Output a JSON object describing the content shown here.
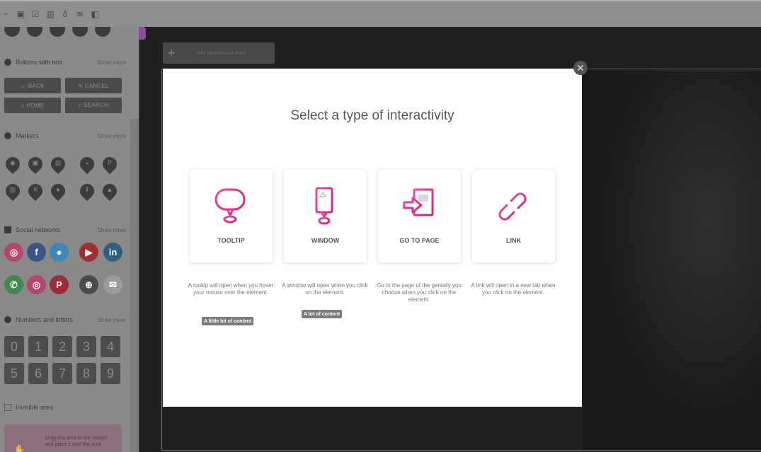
{
  "toolbar": {
    "icons": [
      "tilde-icon",
      "copy-icon",
      "checklist-icon",
      "trash-icon",
      "lock-icon",
      "layers-icon",
      "panel-icon"
    ]
  },
  "sidebar": {
    "buttons_section": {
      "title": "Buttons with text",
      "show_more": "Show more"
    },
    "text_buttons": [
      "← BACK",
      "✕ CANCEL",
      "⌂ HOME",
      "⌕ SEARCH"
    ],
    "markers_section": {
      "title": "Markers",
      "show_more": "Show more"
    },
    "social_section": {
      "title": "Social networks",
      "show_more": "Show more"
    },
    "social_icons": [
      {
        "name": "instagram-icon",
        "glyph": "◎",
        "color": "#b5456f"
      },
      {
        "name": "facebook-icon",
        "glyph": "f",
        "color": "#3a548a"
      },
      {
        "name": "twitter-icon",
        "glyph": "●",
        "color": "#3d86b5"
      },
      {
        "name": "youtube-icon",
        "glyph": "▶",
        "color": "#a32d2d"
      },
      {
        "name": "linkedin-icon",
        "glyph": "in",
        "color": "#2f5f80"
      },
      {
        "name": "whatsapp-icon",
        "glyph": "✆",
        "color": "#3d8b4a"
      },
      {
        "name": "instagram-icon-2",
        "glyph": "◎",
        "color": "#b5456f"
      },
      {
        "name": "pinterest-icon",
        "glyph": "P",
        "color": "#a02a36"
      },
      {
        "name": "web-icon",
        "glyph": "⊕",
        "color": "#4a4a4a"
      },
      {
        "name": "mail-icon",
        "glyph": "✉",
        "color": "#9a9a9a"
      }
    ],
    "numbers_section": {
      "title": "Numbers and letters",
      "show_more": "Show more"
    },
    "numbers": [
      "0",
      "1",
      "2",
      "3",
      "4",
      "5",
      "6",
      "7",
      "8",
      "9"
    ],
    "invisible_area": "Invisible area",
    "drag_text": "Drag this area to the canvas and place it over the area"
  },
  "canvas": {
    "add_bar_text": "Add background audio"
  },
  "modal": {
    "title": "Select a type of interactivity",
    "accent": "#e0268a",
    "options": [
      {
        "label": "TOOLTIP",
        "description": "A tooltip will open when you hover your mouse over the element.",
        "badge": "A little bit of content"
      },
      {
        "label": "WINDOW",
        "description": "A window will open when you click on the element.",
        "badge": "A lot of content"
      },
      {
        "label": "GO TO PAGE",
        "description": "Go to the page of the genially you choose when you click on the element.",
        "badge": ""
      },
      {
        "label": "LINK",
        "description": "A link will open in a new tab when you click on the element.",
        "badge": ""
      }
    ]
  }
}
